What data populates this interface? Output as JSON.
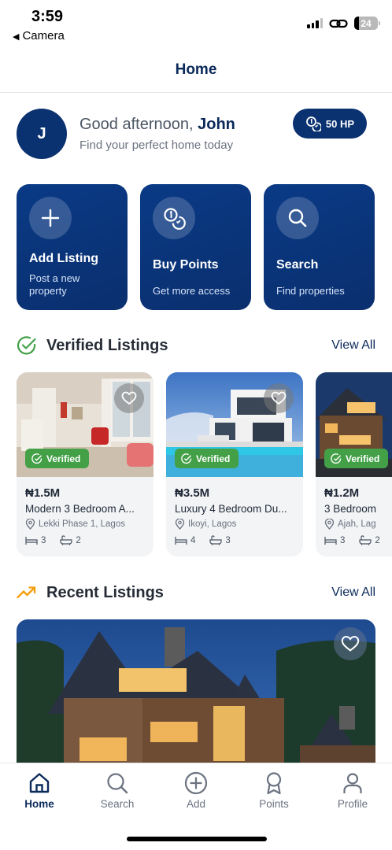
{
  "status_bar": {
    "time": "3:59",
    "back_label": "Camera",
    "battery": "24"
  },
  "header": {
    "title": "Home"
  },
  "greeting": {
    "avatar_initial": "J",
    "salutation": "Good afternoon,",
    "name": "John",
    "subtitle": "Find your perfect home today",
    "points_badge": "50 HP"
  },
  "actions": [
    {
      "title": "Add Listing",
      "subtitle": "Post a new property",
      "icon": "plus-icon"
    },
    {
      "title": "Buy Points",
      "subtitle": "Get more access",
      "icon": "coins-icon"
    },
    {
      "title": "Search",
      "subtitle": "Find properties",
      "icon": "search-icon"
    }
  ],
  "verified": {
    "title": "Verified Listings",
    "view_all": "View All",
    "badge_label": "Verified",
    "listings": [
      {
        "price": "₦1.5M",
        "name": "Modern 3 Bedroom A...",
        "location": "Lekki Phase 1, Lagos",
        "beds": "3",
        "baths": "2"
      },
      {
        "price": "₦3.5M",
        "name": "Luxury 4 Bedroom Du...",
        "location": "Ikoyi, Lagos",
        "beds": "4",
        "baths": "3"
      },
      {
        "price": "₦1.2M",
        "name": "3 Bedroom",
        "location": "Ajah, Lag",
        "beds": "3",
        "baths": "2"
      }
    ]
  },
  "recent": {
    "title": "Recent Listings",
    "view_all": "View All"
  },
  "tabbar": [
    {
      "label": "Home",
      "icon": "home-icon",
      "active": true
    },
    {
      "label": "Search",
      "icon": "search-icon",
      "active": false
    },
    {
      "label": "Add",
      "icon": "add-circle-icon",
      "active": false
    },
    {
      "label": "Points",
      "icon": "award-icon",
      "active": false
    },
    {
      "label": "Profile",
      "icon": "user-icon",
      "active": false
    }
  ],
  "colors": {
    "brand": "#0b3270",
    "accent_green": "#43a047",
    "accent_orange": "#f59e0b"
  }
}
